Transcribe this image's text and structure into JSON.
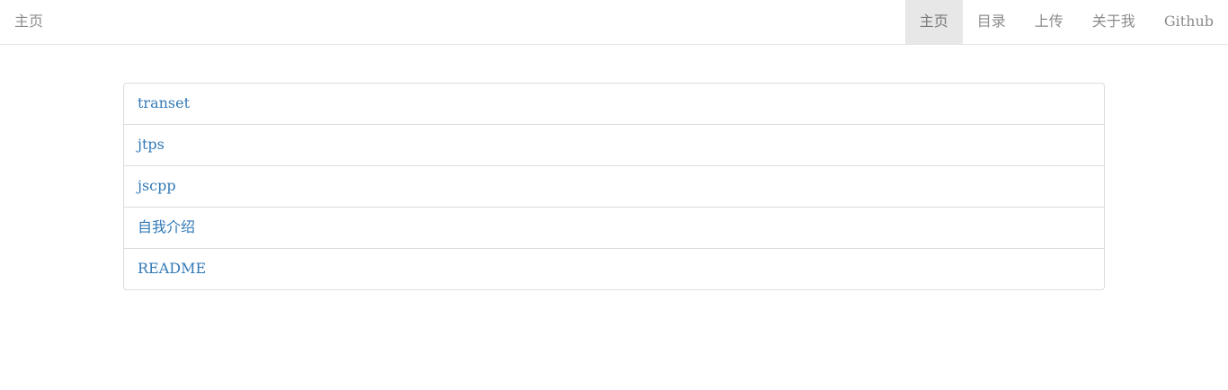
{
  "navbar": {
    "brand": "主页",
    "items": [
      {
        "label": "主页",
        "active": true
      },
      {
        "label": "目录",
        "active": false
      },
      {
        "label": "上传",
        "active": false
      },
      {
        "label": "关于我",
        "active": false
      },
      {
        "label": "Github",
        "active": false
      }
    ]
  },
  "list": {
    "items": [
      {
        "label": "transet"
      },
      {
        "label": "jtps"
      },
      {
        "label": "jscpp"
      },
      {
        "label": "自我介绍"
      },
      {
        "label": "README"
      }
    ]
  },
  "colors": {
    "link": "#337ab7",
    "nav_text": "#8c8c8c",
    "nav_active_bg": "#e7e7e7",
    "border": "#dddddd"
  }
}
